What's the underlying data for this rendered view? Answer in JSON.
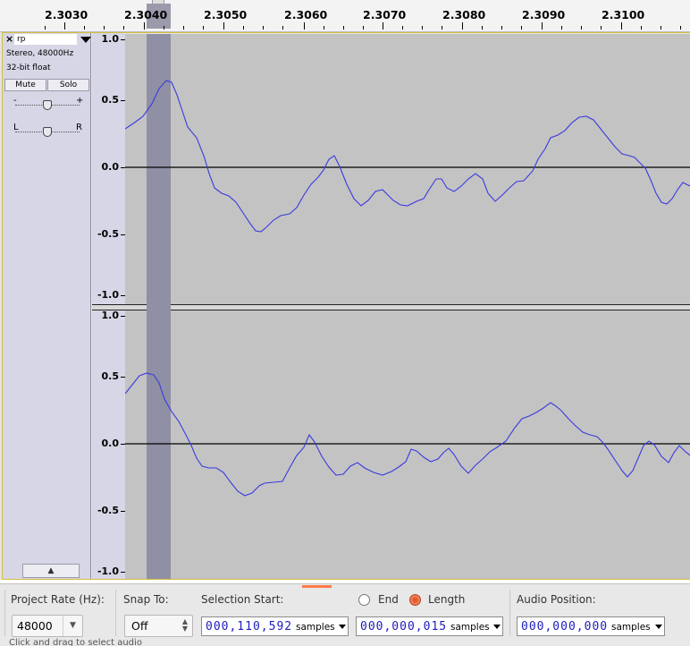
{
  "timeline": {
    "ticks": [
      "2.3030",
      "2.3040",
      "2.3050",
      "2.3060",
      "2.3070",
      "2.3080",
      "2.3090",
      "2.3100"
    ]
  },
  "track": {
    "name": "rp",
    "format_line1": "Stereo, 48000Hz",
    "format_line2": "32-bit float",
    "mute_label": "Mute",
    "solo_label": "Solo",
    "gain_minus": "-",
    "gain_plus": "+",
    "pan_left": "L",
    "pan_right": "R",
    "close_icon": "×",
    "collapse_icon": "▲"
  },
  "vertical_ruler": {
    "channel_1": [
      "1.0",
      "0.5",
      "0.0",
      "-0.5",
      "-1.0"
    ],
    "channel_2": [
      "1.0",
      "0.5",
      "0.0",
      "-0.5",
      "-1.0"
    ]
  },
  "selection": {
    "start_seconds": 2.304,
    "end_seconds": 2.30431,
    "color": "#8f8fa5"
  },
  "colors": {
    "waveform": "#3a3ae0",
    "wave_background": "#c3c3c3",
    "radio_accent": "#e05a31",
    "digits": "#1d1dbb"
  },
  "toolbar": {
    "project_rate_label": "Project Rate (Hz):",
    "project_rate_value": "48000",
    "snap_to_label": "Snap To:",
    "snap_to_value": "Off",
    "selection_start_label": "Selection Start:",
    "end_label": "End",
    "length_label": "Length",
    "length_selected": true,
    "audio_position_label": "Audio Position:",
    "selection_start_digits": "000,110,592",
    "selection_start_unit": "samples",
    "length_digits": "000,000,015",
    "length_unit": "samples",
    "audio_position_digits": "000,000,000",
    "audio_position_unit": "samples"
  },
  "status": {
    "text": "Click and drag to select audio"
  }
}
